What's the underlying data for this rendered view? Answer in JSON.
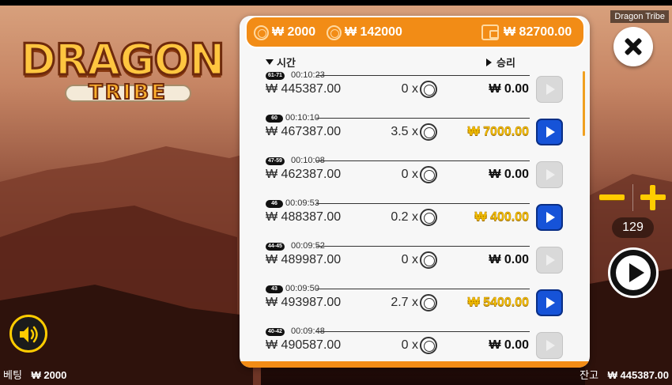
{
  "window": {
    "title": "Dragon Tribe"
  },
  "logo": {
    "word": "DRAGON",
    "sub": "TRIBE"
  },
  "header": {
    "bet": "₩ 2000",
    "total": "₩ 142000",
    "wallet": "₩ 82700.00"
  },
  "columns": {
    "time": "시간",
    "win": "승리"
  },
  "rows": [
    {
      "badge": "61-71",
      "time": "00:10:23",
      "balance": "₩ 445387.00",
      "mult": "0 x",
      "win": "₩ 0.00",
      "gold": false
    },
    {
      "badge": "60",
      "time": "00:10:10",
      "balance": "₩ 467387.00",
      "mult": "3.5 x",
      "win": "₩ 7000.00",
      "gold": true
    },
    {
      "badge": "47-59",
      "time": "00:10:08",
      "balance": "₩ 462387.00",
      "mult": "0 x",
      "win": "₩ 0.00",
      "gold": false
    },
    {
      "badge": "46",
      "time": "00:09:53",
      "balance": "₩ 488387.00",
      "mult": "0.2 x",
      "win": "₩ 400.00",
      "gold": true
    },
    {
      "badge": "44-45",
      "time": "00:09:52",
      "balance": "₩ 489987.00",
      "mult": "0 x",
      "win": "₩ 0.00",
      "gold": false
    },
    {
      "badge": "43",
      "time": "00:09:50",
      "balance": "₩ 493987.00",
      "mult": "2.7 x",
      "win": "₩ 5400.00",
      "gold": true
    },
    {
      "badge": "40-42",
      "time": "00:09:48",
      "balance": "₩ 490587.00",
      "mult": "0 x",
      "win": "₩ 0.00",
      "gold": false
    }
  ],
  "controls": {
    "round_count": "129"
  },
  "footer": {
    "bet_label": "베팅",
    "bet_value": "₩ 2000",
    "balance_label": "잔고",
    "balance_value": "₩ 445387.00"
  },
  "colors": {
    "accent": "#f28c16",
    "gold": "#f5c000",
    "replay_active": "#1653d8"
  }
}
